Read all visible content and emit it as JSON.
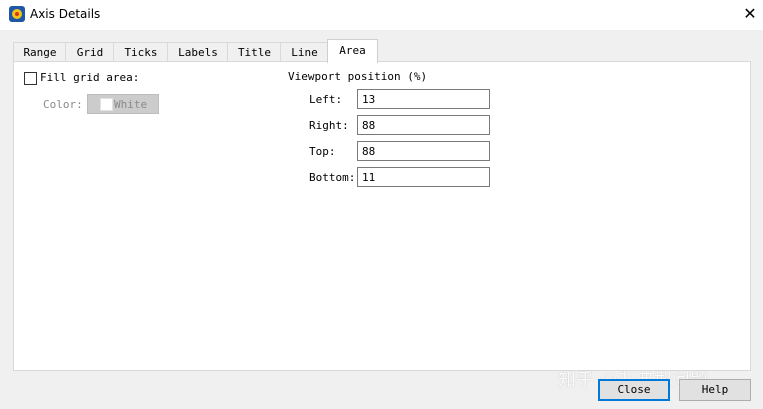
{
  "window": {
    "title": "Axis Details"
  },
  "tabs": [
    "Range",
    "Grid",
    "Ticks",
    "Labels",
    "Title",
    "Line",
    "Area"
  ],
  "active_tab": "Area",
  "fill": {
    "label": "Fill grid area:",
    "checked": false
  },
  "color": {
    "label": "Color:",
    "value": "White"
  },
  "viewport": {
    "heading": "Viewport position (%)",
    "fields": [
      {
        "label": "Left:",
        "value": "13"
      },
      {
        "label": "Right:",
        "value": "88"
      },
      {
        "label": "Top:",
        "value": "88"
      },
      {
        "label": "Bottom:",
        "value": "11"
      }
    ]
  },
  "buttons": {
    "close": "Close",
    "help": "Help"
  },
  "watermark": "知乎 @非典型问题",
  "colors": {
    "default_button_border": "#0078d7",
    "disabled_text": "#8a8a8a"
  }
}
